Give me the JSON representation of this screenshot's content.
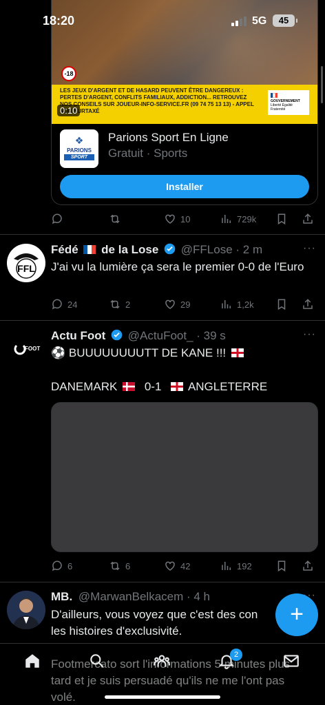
{
  "status_bar": {
    "time": "18:20",
    "network": "5G",
    "battery": "45"
  },
  "ad": {
    "duration": "0:10",
    "age_badge": "-18",
    "warning_text": "LES JEUX D'ARGENT ET DE HASARD PEUVENT ÊTRE DANGEREUX : PERTES D'ARGENT, CONFLITS FAMILIAUX, ADDICTION... RETROUVEZ NOS CONSEILS SUR JOUEUR-INFO-SERVICE.FR (09 74 75 13 13) - APPEL NON SURTAXÉ",
    "gov_label": "GOUVERNEMENT",
    "gov_sub": "Liberté Égalité Fraternité",
    "app_logo_top": "PARIONS",
    "app_logo_bottom": "SPORT",
    "app_name": "Parions Sport En Ligne",
    "app_meta": "Gratuit · Sports",
    "install_label": "Installer",
    "stats": {
      "replies": "",
      "retweets": "",
      "likes": "10",
      "views": "729k"
    }
  },
  "tweets": [
    {
      "name": "Fédé",
      "name_suffix": "de la Lose",
      "handle": "@FFLose · 2 m",
      "avatar_text": "FFL",
      "text": "J'ai vu la lumière ça sera le premier 0-0 de l'Euro",
      "stats": {
        "replies": "24",
        "retweets": "2",
        "likes": "29",
        "views": "1,2k"
      }
    },
    {
      "name": "Actu Foot",
      "handle": "@ActuFoot_ · 39 s",
      "avatar_text": "FOOT",
      "text_line1": "⚽ BUUUUUUUUTT DE KANE !!!",
      "text_line2_a": "DANEMARK",
      "text_line2_b": "0-1",
      "text_line2_c": "ANGLETERRE",
      "stats": {
        "replies": "6",
        "retweets": "6",
        "likes": "42",
        "views": "192"
      }
    },
    {
      "name": "MB.",
      "handle": "@MarwanBelkacem · 4 h",
      "text_line1": "D'ailleurs, vous voyez que c'est des con",
      "text_line2": "les histoires d'exclusivité.",
      "text_line3": "Footmercato sort l'informations 5 minutes plus",
      "text_line4": "tard et je suis persuadé qu'ils ne me l'ont pas",
      "text_line5": "volé."
    }
  ],
  "fab_label": "+",
  "nav": {
    "notifications_badge": "2"
  },
  "colors": {
    "accent": "#1d9bf0",
    "background": "#000000",
    "muted": "#71767b"
  }
}
